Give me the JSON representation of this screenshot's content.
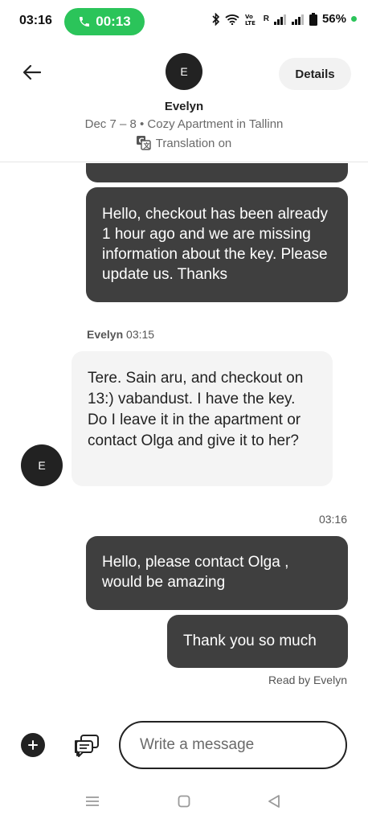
{
  "status_bar": {
    "time": "03:16",
    "call_timer": "00:13",
    "network_label": "R",
    "battery": "56%"
  },
  "header": {
    "avatar_initial": "E",
    "name": "Evelyn",
    "subtitle": "Dec 7 – 8 • Cozy Apartment in Tallinn",
    "translation": "Translation on",
    "details_label": "Details"
  },
  "messages": [
    {
      "direction": "out",
      "text": "Hello, checkout has been already 1 hour ago and we are missing information about the key. Please update us. Thanks"
    },
    {
      "direction": "in",
      "sender": "Evelyn",
      "time": "03:15",
      "avatar_initial": "E",
      "text": "Tere. Sain aru, and checkout on 13:) vabandust. I have the key. Do I leave it in the apartment or contact Olga and give it to her?"
    },
    {
      "direction": "out",
      "time": "03:16",
      "text": "Hello, please contact Olga , would be amazing"
    },
    {
      "direction": "out",
      "text": "Thank you so much"
    }
  ],
  "read_receipt": "Read by Evelyn",
  "composer": {
    "placeholder": "Write a message"
  },
  "colors": {
    "call_green": "#2bc45a",
    "outgoing_bubble": "#3f3f3f",
    "incoming_bubble": "#f4f4f4",
    "avatar": "#222222"
  },
  "icons": {
    "back": "arrow-left-icon",
    "translation": "translate-icon",
    "add": "plus-icon",
    "quick_replies": "chat-bubbles-icon",
    "nav_menu": "menu-icon",
    "nav_home": "home-square-icon",
    "nav_back": "back-triangle-icon"
  }
}
